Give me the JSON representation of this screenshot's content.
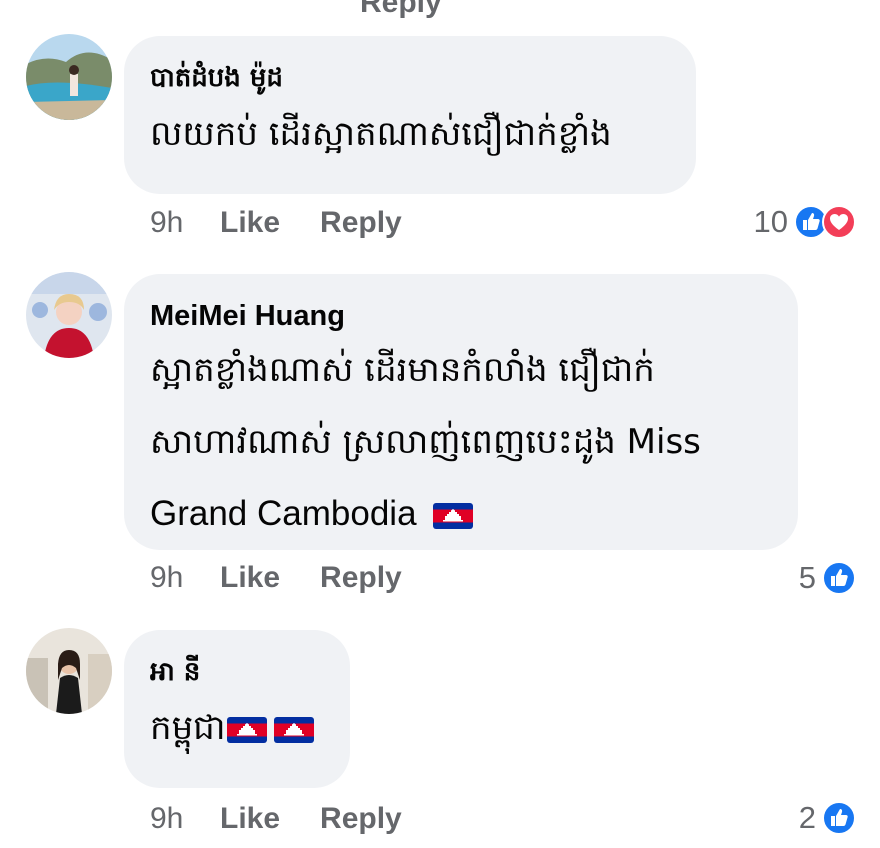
{
  "top_cut_text": "Reply",
  "colors": {
    "like_blue": "#1877f2",
    "love_red": "#f33e58",
    "bubble_bg": "#f0f2f5",
    "meta_gray": "#65676b",
    "flag_blue": "#032ea1",
    "flag_red": "#e00025"
  },
  "comments": [
    {
      "author": "បាត់ដំបង ម៉ូដ",
      "lines": [
        "លយកប់ ដើរស្អាតណាស់ជឿជាក់ខ្លាំង"
      ],
      "time": "9h",
      "like_label": "Like",
      "reply_label": "Reply",
      "reaction_count": "10",
      "reaction_icons": [
        "like-icon",
        "love-icon"
      ]
    },
    {
      "author": "MeiMei Huang",
      "lines": [
        "ស្អាតខ្លាំងណាស់ ដើរមានកំលាំង ជឿជាក់",
        "សាហាវណាស់ ស្រលាញ់ពេញបេះដូង Miss",
        "Grand Cambodia"
      ],
      "line_flags": [
        "cambodia-flag"
      ],
      "time": "9h",
      "like_label": "Like",
      "reply_label": "Reply",
      "reaction_count": "5",
      "reaction_icons": [
        "like-icon"
      ]
    },
    {
      "author": "អា នី",
      "lines": [
        "កម្ពុជា"
      ],
      "line_flags": [
        "cambodia-flag",
        "cambodia-flag"
      ],
      "time": "9h",
      "like_label": "Like",
      "reply_label": "Reply",
      "reaction_count": "2",
      "reaction_icons": [
        "like-icon"
      ]
    }
  ]
}
